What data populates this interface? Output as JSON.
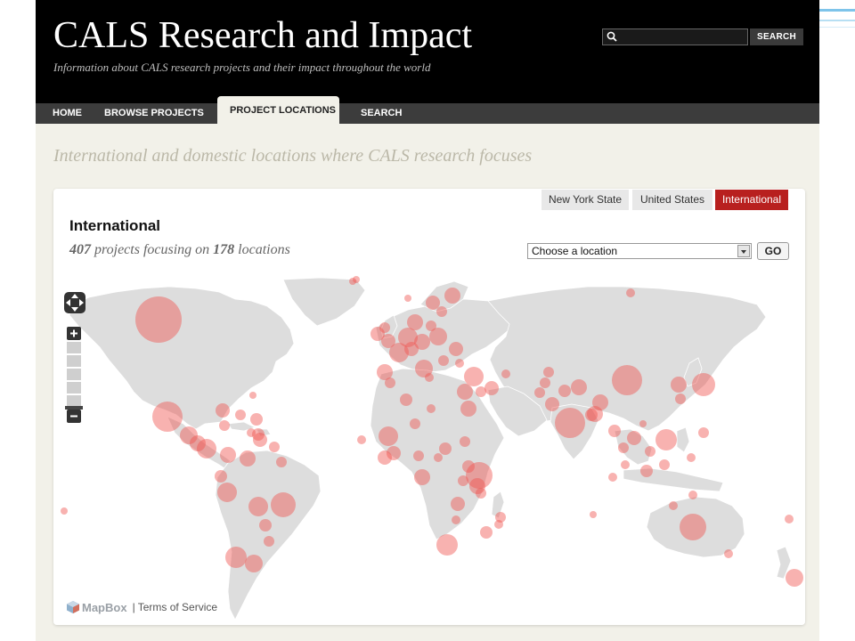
{
  "header": {
    "title": "CALS Research and Impact",
    "tagline": "Information about CALS research projects and their impact throughout the world",
    "search": {
      "placeholder": "",
      "value": "",
      "button_label": "SEARCH"
    }
  },
  "nav": {
    "items": [
      {
        "label": "HOME"
      },
      {
        "label": "BROWSE PROJECTS"
      },
      {
        "label": "PROJECT LOCATIONS",
        "active": true
      },
      {
        "label": "SEARCH"
      }
    ]
  },
  "page": {
    "heading": "International and domestic locations where CALS research focuses"
  },
  "panel": {
    "view_tabs": [
      {
        "label": "New York State"
      },
      {
        "label": "United States"
      },
      {
        "label": "International",
        "active": true
      }
    ],
    "region_title": "International",
    "summary": {
      "project_count": "407",
      "text_middle": " projects focusing on ",
      "location_count": "178",
      "text_end": " locations"
    },
    "location_select": {
      "value": "Choose a location"
    },
    "go_label": "GO"
  },
  "map": {
    "controls": {
      "zoom_in": "+",
      "zoom_out": "−"
    },
    "credit": {
      "logo_text": "MapBox",
      "separator": "|",
      "link": "Terms of Service"
    }
  },
  "colors": {
    "header_bg": "#000000",
    "page_bg": "#f2f1e9",
    "nav_bg": "#3c3c3c",
    "accent_red": "#b8201f",
    "marker": "#f0544f",
    "land": "#dddddd",
    "water": "#ffffff"
  },
  "icons": {
    "search": "magnifier-icon",
    "pan": "pan-arrows-icon",
    "zoom_in": "plus-icon",
    "zoom_out": "minus-icon",
    "logo": "mapbox-cube-icon",
    "dropdown": "chevron-down-icon"
  }
}
